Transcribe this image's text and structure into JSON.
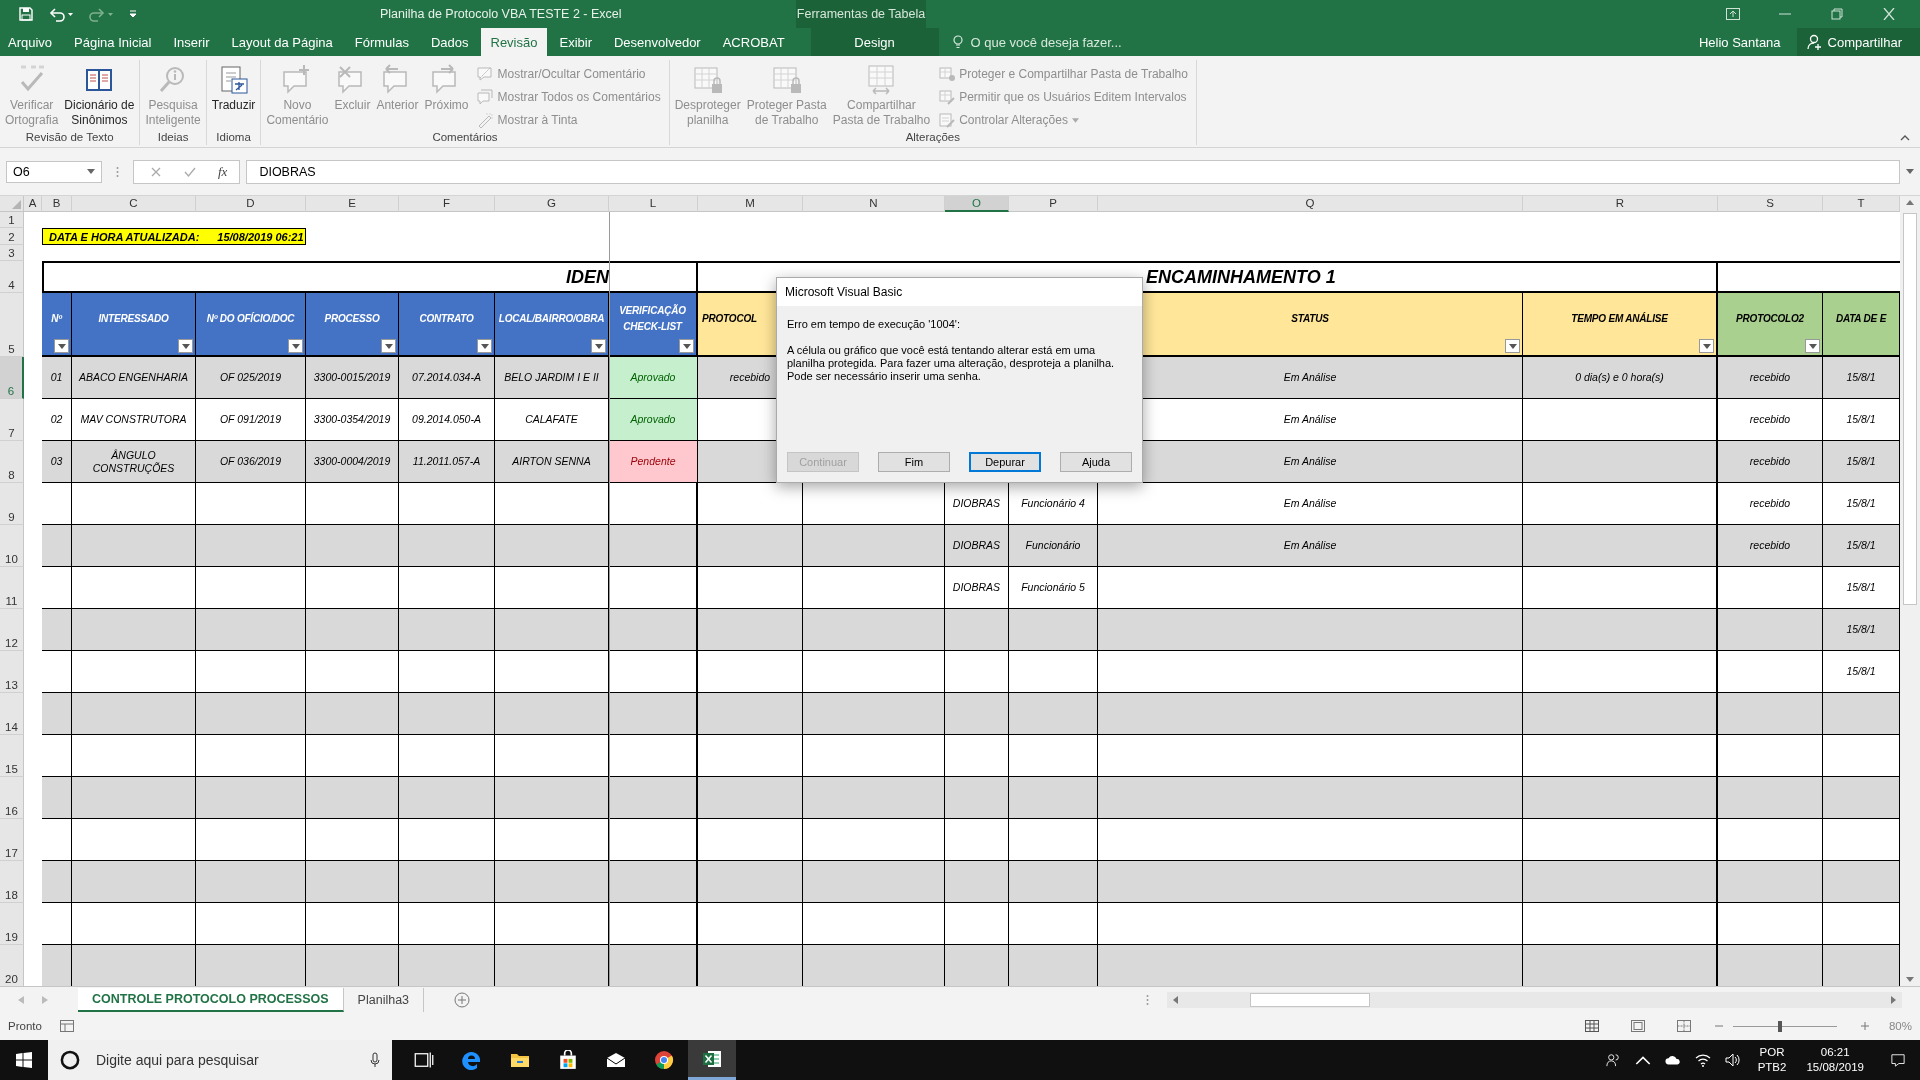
{
  "window": {
    "title": "Planilha de Protocolo VBA TESTE 2 - Excel",
    "context_label": "Ferramentas de Tabela"
  },
  "tabs": [
    {
      "label": "Arquivo",
      "selected": false,
      "kind": "normal"
    },
    {
      "label": "Página Inicial",
      "selected": false,
      "kind": "normal"
    },
    {
      "label": "Inserir",
      "selected": false,
      "kind": "normal"
    },
    {
      "label": "Layout da Página",
      "selected": false,
      "kind": "normal"
    },
    {
      "label": "Fórmulas",
      "selected": false,
      "kind": "normal"
    },
    {
      "label": "Dados",
      "selected": false,
      "kind": "normal"
    },
    {
      "label": "Revisão",
      "selected": true,
      "kind": "normal"
    },
    {
      "label": "Exibir",
      "selected": false,
      "kind": "normal"
    },
    {
      "label": "Desenvolvedor",
      "selected": false,
      "kind": "normal"
    },
    {
      "label": "ACROBAT",
      "selected": false,
      "kind": "normal"
    },
    {
      "label": "Design",
      "selected": false,
      "kind": "contextual"
    }
  ],
  "tell_me": {
    "placeholder": "O que você deseja fazer..."
  },
  "user": "Helio Santana",
  "share_button": "Compartilhar",
  "ribbon": {
    "groups": [
      {
        "label": "Revisão de Texto",
        "items": [
          {
            "kind": "large",
            "label": "Verificar\nOrtografia",
            "disabled": true
          },
          {
            "kind": "large",
            "label": "Dicionário de\nSinônimos",
            "disabled": false
          }
        ]
      },
      {
        "label": "Ideias",
        "items": [
          {
            "kind": "large",
            "label": "Pesquisa\nInteligente",
            "disabled": true
          }
        ]
      },
      {
        "label": "Idioma",
        "items": [
          {
            "kind": "large",
            "label": "Traduzir",
            "disabled": false
          }
        ]
      },
      {
        "label": "Comentários",
        "items": [
          {
            "kind": "large",
            "label": "Novo\nComentário",
            "disabled": true
          },
          {
            "kind": "large",
            "label": "Excluir",
            "disabled": true
          },
          {
            "kind": "large",
            "label": "Anterior",
            "disabled": true
          },
          {
            "kind": "large",
            "label": "Próximo",
            "disabled": true
          },
          {
            "kind": "small",
            "label": "Mostrar/Ocultar Comentário",
            "disabled": true
          },
          {
            "kind": "small",
            "label": "Mostrar Todos os Comentários",
            "disabled": true
          },
          {
            "kind": "small",
            "label": "Mostrar à Tinta",
            "disabled": true
          }
        ]
      },
      {
        "label": "Alterações",
        "items": [
          {
            "kind": "large",
            "label": "Desproteger\nplanilha",
            "disabled": true
          },
          {
            "kind": "large",
            "label": "Proteger Pasta\nde Trabalho",
            "disabled": true
          },
          {
            "kind": "large",
            "label": "Compartilhar\nPasta de Trabalho",
            "disabled": true
          },
          {
            "kind": "small",
            "label": "Proteger e Compartilhar Pasta de Trabalho",
            "disabled": true
          },
          {
            "kind": "small",
            "label": "Permitir que os Usuários Editem Intervalos",
            "disabled": true
          },
          {
            "kind": "small",
            "label": "Controlar Alterações",
            "disabled": true,
            "caret": true
          }
        ]
      }
    ]
  },
  "formula_bar": {
    "name_box": "O6",
    "fx": "fx",
    "value": "DIOBRAS"
  },
  "sheet": {
    "columns": [
      {
        "letter": "A",
        "selected": false
      },
      {
        "letter": "B",
        "selected": false,
        "header": "Nº",
        "color": "#4472c4",
        "filter": true
      },
      {
        "letter": "C",
        "selected": false,
        "header": "INTERESSADO",
        "color": "#4472c4",
        "filter": true
      },
      {
        "letter": "D",
        "selected": false,
        "header": "Nº DO OFÍCIO/DOC",
        "color": "#4472c4",
        "filter": true
      },
      {
        "letter": "E",
        "selected": false,
        "header": "PROCESSO",
        "color": "#4472c4",
        "filter": true
      },
      {
        "letter": "F",
        "selected": false,
        "header": "CONTRATO",
        "color": "#4472c4",
        "filter": true
      },
      {
        "letter": "G",
        "selected": false,
        "header": "LOCAL/BAIRRO/OBRA",
        "color": "#4472c4",
        "filter": true
      },
      {
        "letter": "L",
        "selected": false,
        "header": "VERIFICAÇÃO CHECK-LIST",
        "color": "#4472c4",
        "filter": true
      },
      {
        "letter": "M",
        "selected": false,
        "header": "PROTOCOL",
        "color": "#ffe699",
        "filter": false
      },
      {
        "letter": "N",
        "selected": false
      },
      {
        "letter": "O",
        "selected": true
      },
      {
        "letter": "P",
        "selected": false
      },
      {
        "letter": "Q",
        "selected": false,
        "header": "STATUS",
        "color": "#ffe699",
        "filter": true
      },
      {
        "letter": "R",
        "selected": false,
        "header": "TEMPO EM ANÁLISE",
        "color": "#ffe699",
        "filter": true
      },
      {
        "letter": "S",
        "selected": false,
        "header": "PROTOCOLO2",
        "color": "#a9d08e",
        "filter": true
      },
      {
        "letter": "T",
        "selected": false,
        "header": "DATA DE E",
        "color": "#a9d08e",
        "filter": false
      }
    ],
    "rows": [
      {
        "num": "1",
        "selected": false,
        "kind": "blank"
      },
      {
        "num": "2",
        "selected": false,
        "kind": "banner",
        "label": "DATA E HORA ATUALIZADA:",
        "value": "15/08/2019 06:21"
      },
      {
        "num": "3",
        "selected": false,
        "kind": "blank"
      },
      {
        "num": "4",
        "selected": false,
        "kind": "group",
        "groups": [
          "IDEN",
          "ENCAMINHAMENTO 1"
        ]
      },
      {
        "num": "5",
        "selected": false,
        "kind": "header"
      },
      {
        "num": "6",
        "selected": true,
        "kind": "data",
        "check": {
          "text": "Aprovado",
          "kind": "approved"
        },
        "cells": [
          null,
          "01",
          "ABACO ENGENHARIA",
          "OF 025/2019",
          "3300-0015/2019",
          "07.2014.034-A",
          "BELO JARDIM I E II",
          null,
          "recebido",
          null,
          null,
          null,
          "Em Análise",
          "0 dia(s) e 0 hora(s)",
          "recebido",
          "15/8/1"
        ]
      },
      {
        "num": "7",
        "selected": false,
        "kind": "data",
        "check": {
          "text": "Aprovado",
          "kind": "approved"
        },
        "cells": [
          null,
          "02",
          "MAV CONSTRUTORA",
          "OF 091/2019",
          "3300-0354/2019",
          "09.2014.050-A",
          "CALAFATE",
          null,
          null,
          null,
          null,
          null,
          "Em Análise",
          null,
          "recebido",
          "15/8/1"
        ]
      },
      {
        "num": "8",
        "selected": false,
        "kind": "data",
        "check": {
          "text": "Pendente",
          "kind": "pending"
        },
        "cells": [
          null,
          "03",
          "ÂNGULO CONSTRUÇÕES",
          "OF 036/2019",
          "3300-0004/2019",
          "11.2011.057-A",
          "AIRTON SENNA",
          null,
          null,
          null,
          null,
          null,
          "Em Análise",
          null,
          "recebido",
          "15/8/1"
        ]
      },
      {
        "num": "9",
        "selected": false,
        "kind": "data",
        "cells": [
          null,
          null,
          null,
          null,
          null,
          null,
          null,
          null,
          null,
          null,
          "DIOBRAS",
          "Funcionário 4",
          "Em Análise",
          null,
          "recebido",
          "15/8/1"
        ]
      },
      {
        "num": "10",
        "selected": false,
        "kind": "data",
        "cells": [
          null,
          null,
          null,
          null,
          null,
          null,
          null,
          null,
          null,
          null,
          "DIOBRAS",
          "Funcionário",
          "Em Análise",
          null,
          "recebido",
          "15/8/1"
        ]
      },
      {
        "num": "11",
        "selected": false,
        "kind": "data",
        "cells": [
          null,
          null,
          null,
          null,
          null,
          null,
          null,
          null,
          null,
          null,
          "DIOBRAS",
          "Funcionário 5",
          null,
          null,
          null,
          "15/8/1"
        ]
      },
      {
        "num": "12",
        "selected": false,
        "kind": "data",
        "cells": [
          null,
          null,
          null,
          null,
          null,
          null,
          null,
          null,
          null,
          null,
          null,
          null,
          null,
          null,
          null,
          "15/8/1"
        ]
      },
      {
        "num": "13",
        "selected": false,
        "kind": "data",
        "cells": [
          null,
          null,
          null,
          null,
          null,
          null,
          null,
          null,
          null,
          null,
          null,
          null,
          null,
          null,
          null,
          "15/8/1"
        ]
      },
      {
        "num": "14",
        "selected": false,
        "kind": "data"
      },
      {
        "num": "15",
        "selected": false,
        "kind": "data"
      },
      {
        "num": "16",
        "selected": false,
        "kind": "data"
      },
      {
        "num": "17",
        "selected": false,
        "kind": "data"
      },
      {
        "num": "18",
        "selected": false,
        "kind": "data"
      },
      {
        "num": "19",
        "selected": false,
        "kind": "data"
      },
      {
        "num": "20",
        "selected": false,
        "kind": "data"
      }
    ]
  },
  "dialog": {
    "title": "Microsoft Visual Basic",
    "heading": "Erro em tempo de execução '1004':",
    "message": "A célula ou gráfico que você está tentando alterar está em uma planilha protegida. Para fazer uma alteração, desproteja a planilha. Pode ser necessário inserir uma senha.",
    "buttons": [
      {
        "label": "Continuar",
        "disabled": true,
        "selected": false
      },
      {
        "label": "Fim",
        "disabled": false,
        "selected": false
      },
      {
        "label": "Depurar",
        "disabled": false,
        "selected": true
      },
      {
        "label": "Ajuda",
        "disabled": false,
        "selected": false
      }
    ]
  },
  "sheet_tabs": [
    {
      "label": "CONTROLE PROTOCOLO PROCESSOS",
      "selected": true
    },
    {
      "label": "Planilha3",
      "selected": false
    }
  ],
  "status_bar": {
    "status": "Pronto",
    "zoom": {
      "level": 0.45,
      "reading": "80%"
    }
  },
  "taskbar": {
    "search": {
      "placeholder": "Digite aqui para pesquisar"
    },
    "language": "POR",
    "layout": "PTB2",
    "time": "06:21",
    "date": "15/08/2019"
  }
}
